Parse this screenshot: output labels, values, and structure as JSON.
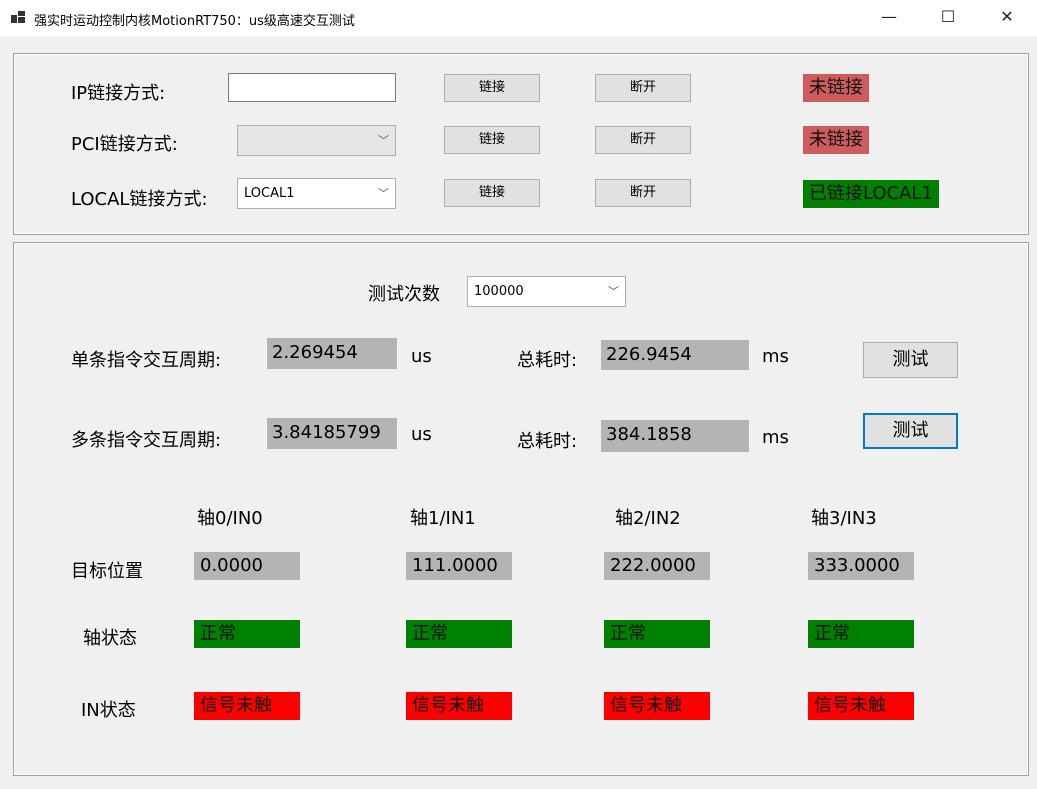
{
  "window": {
    "title": "强实时运动控制内核MotionRT750：us级高速交互测试"
  },
  "connection": {
    "rows": [
      {
        "label": "IP链接方式:",
        "input_value": "",
        "connect_label": "链接",
        "disconnect_label": "断开",
        "status": "未链接",
        "status_color": "#cd5c5c"
      },
      {
        "label": "PCI链接方式:",
        "combo_value": "",
        "connect_label": "链接",
        "disconnect_label": "断开",
        "status": "未链接",
        "status_color": "#cd5c5c"
      },
      {
        "label": "LOCAL链接方式:",
        "combo_value": "LOCAL1",
        "connect_label": "链接",
        "disconnect_label": "断开",
        "status": "已链接LOCAL1",
        "status_color": "#008000"
      }
    ]
  },
  "test": {
    "count_label": "测试次数",
    "count_value": "100000",
    "single": {
      "label": "单条指令交互周期:",
      "value": "2.269454",
      "unit": "us",
      "total_label": "总耗时:",
      "total_value": "226.9454",
      "total_unit": "ms",
      "button": "测试"
    },
    "multi": {
      "label": "多条指令交互周期:",
      "value": "3.84185799",
      "unit": "us",
      "total_label": "总耗时:",
      "total_value": "384.1858",
      "total_unit": "ms",
      "button": "测试"
    }
  },
  "axes": {
    "headers": [
      "轴0/IN0",
      "轴1/IN1",
      "轴2/IN2",
      "轴3/IN3"
    ],
    "target_label": "目标位置",
    "targets": [
      "0.0000",
      "111.0000",
      "222.0000",
      "333.0000"
    ],
    "state_label": "轴状态",
    "states": [
      "正常",
      "正常",
      "正常",
      "正常"
    ],
    "in_label": "IN状态",
    "ins": [
      "信号未触",
      "信号未触",
      "信号未触",
      "信号未触"
    ],
    "colors": {
      "ok": "#008000",
      "signal": "#ff0000",
      "value_bg": "#b4b4b4"
    }
  }
}
